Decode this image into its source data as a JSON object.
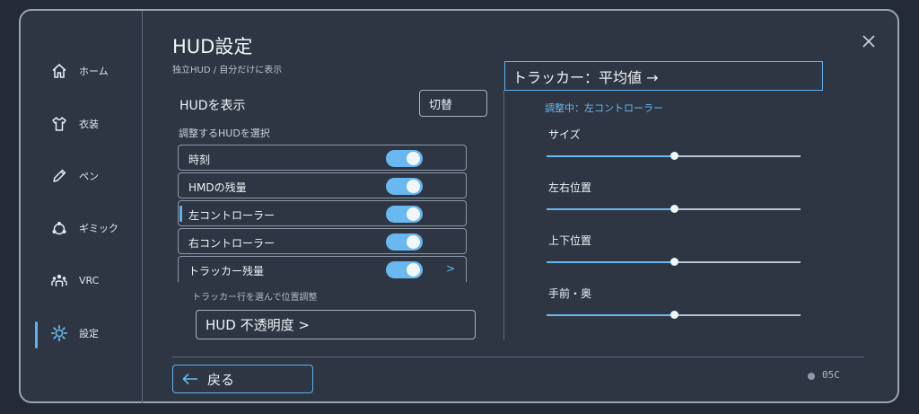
{
  "nav": {
    "items": [
      {
        "label": "ホーム",
        "icon": "home-icon"
      },
      {
        "label": "衣装",
        "icon": "shirt-icon"
      },
      {
        "label": "ペン",
        "icon": "pen-icon"
      },
      {
        "label": "ギミック",
        "icon": "gimmick-icon"
      },
      {
        "label": "VRC",
        "icon": "users-icon"
      },
      {
        "label": "設定",
        "icon": "gear-icon",
        "active": true
      }
    ]
  },
  "header": {
    "title": "HUD設定",
    "subtitle": "独立HUD / 自分だけに表示"
  },
  "show_hud": {
    "label": "HUDを表示",
    "button": "切替"
  },
  "hud_select": {
    "label": "調整するHUDを選択",
    "rows": [
      {
        "label": "時刻",
        "enabled": true
      },
      {
        "label": "HMDの残量",
        "enabled": true
      },
      {
        "label": "左コントローラー",
        "enabled": true,
        "selected": true
      },
      {
        "label": "右コントローラー",
        "enabled": true
      },
      {
        "label": "トラッカー残量",
        "enabled": true,
        "chevron": ">"
      }
    ],
    "hint": "トラッカー行を選んで位置調整",
    "opacity_button": "HUD 不透明度 >"
  },
  "tracker": {
    "header": "トラッカー：平均値 →",
    "adjusting": "調整中：左コントローラー",
    "sliders": [
      {
        "label": "サイズ",
        "value": 0.5
      },
      {
        "label": "左右位置",
        "value": 0.5
      },
      {
        "label": "上下位置",
        "value": 0.5
      },
      {
        "label": "手前・奥",
        "value": 0.5
      }
    ]
  },
  "footer": {
    "back": "戻る",
    "status": "05C"
  },
  "colors": {
    "accent": "#5fb1ef",
    "panel": "#2e3643",
    "background": "#242b36"
  }
}
